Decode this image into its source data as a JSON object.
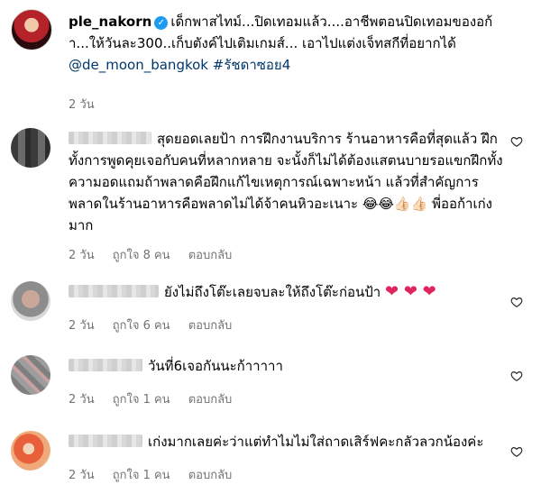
{
  "post": {
    "username": "ple_nakorn",
    "caption": "เด็กพาสไทม์...ปิดเทอมแล้ว....อาชีพตอนปิดเทอมของอก้า...ให้วันละ300..เก็บตังค์ไปเติมเกมส์... เอาไปแต่งเจ็ทสกีที่อยากได้",
    "mention": "@de_moon_bangkok",
    "hashtag": "#รัชดาซอย4",
    "time": "2 วัน"
  },
  "comments": [
    {
      "text": "สุดยอดเลยป้า การฝึกงานบริการ ร้านอาหารคือที่สุดแล้ว ฝึกทั้งการพูดคุยเจอกับคนที่หลากหลาย จะนั้งก็ไม่ได้ต้องแสตนบายรอแขกฝึกทั้งความอดแถมถ้าพลาดคือฝึกแก้ไขเหตุการณ์เฉพาะหน้า แล้วที่สำคัญการพลาดในร้านอาหารคือพลาดไม่ได้จ้าคนหิวอะเนาะ",
      "emojis": "😂😂👍🏻👍🏻",
      "tail": " พี่ออก้าเก่งมาก",
      "time": "2 วัน",
      "likes": "ถูกใจ 8 คน",
      "reply": "ตอบกลับ"
    },
    {
      "text": "ยังไม่ถึงโต๊ะเลยจบละให้ถึงโต๊ะก่อนป้า",
      "hearts": "❤ ❤ ❤",
      "time": "2 วัน",
      "likes": "ถูกใจ 6 คน",
      "reply": "ตอบกลับ"
    },
    {
      "text": "วันที่6เจอกันนะก้าาาาา",
      "time": "2 วัน",
      "likes": "ถูกใจ 1 คน",
      "reply": "ตอบกลับ"
    },
    {
      "text": "เก่งมากเลยค่ะว่าแต่ทำไมไม่ใส่ถาดเสิร์ฟคะกลัวลวกน้องค่ะ",
      "time": "2 วัน",
      "likes": "ถูกใจ 1 คน",
      "reply": "ตอบกลับ"
    }
  ],
  "colors": {
    "link": "#00376b",
    "muted": "#737373",
    "verified": "#1d9bf0",
    "heart_emoji": "#e0245e"
  },
  "icons": {
    "verified": "verified-badge-icon",
    "like": "heart-outline-icon"
  }
}
